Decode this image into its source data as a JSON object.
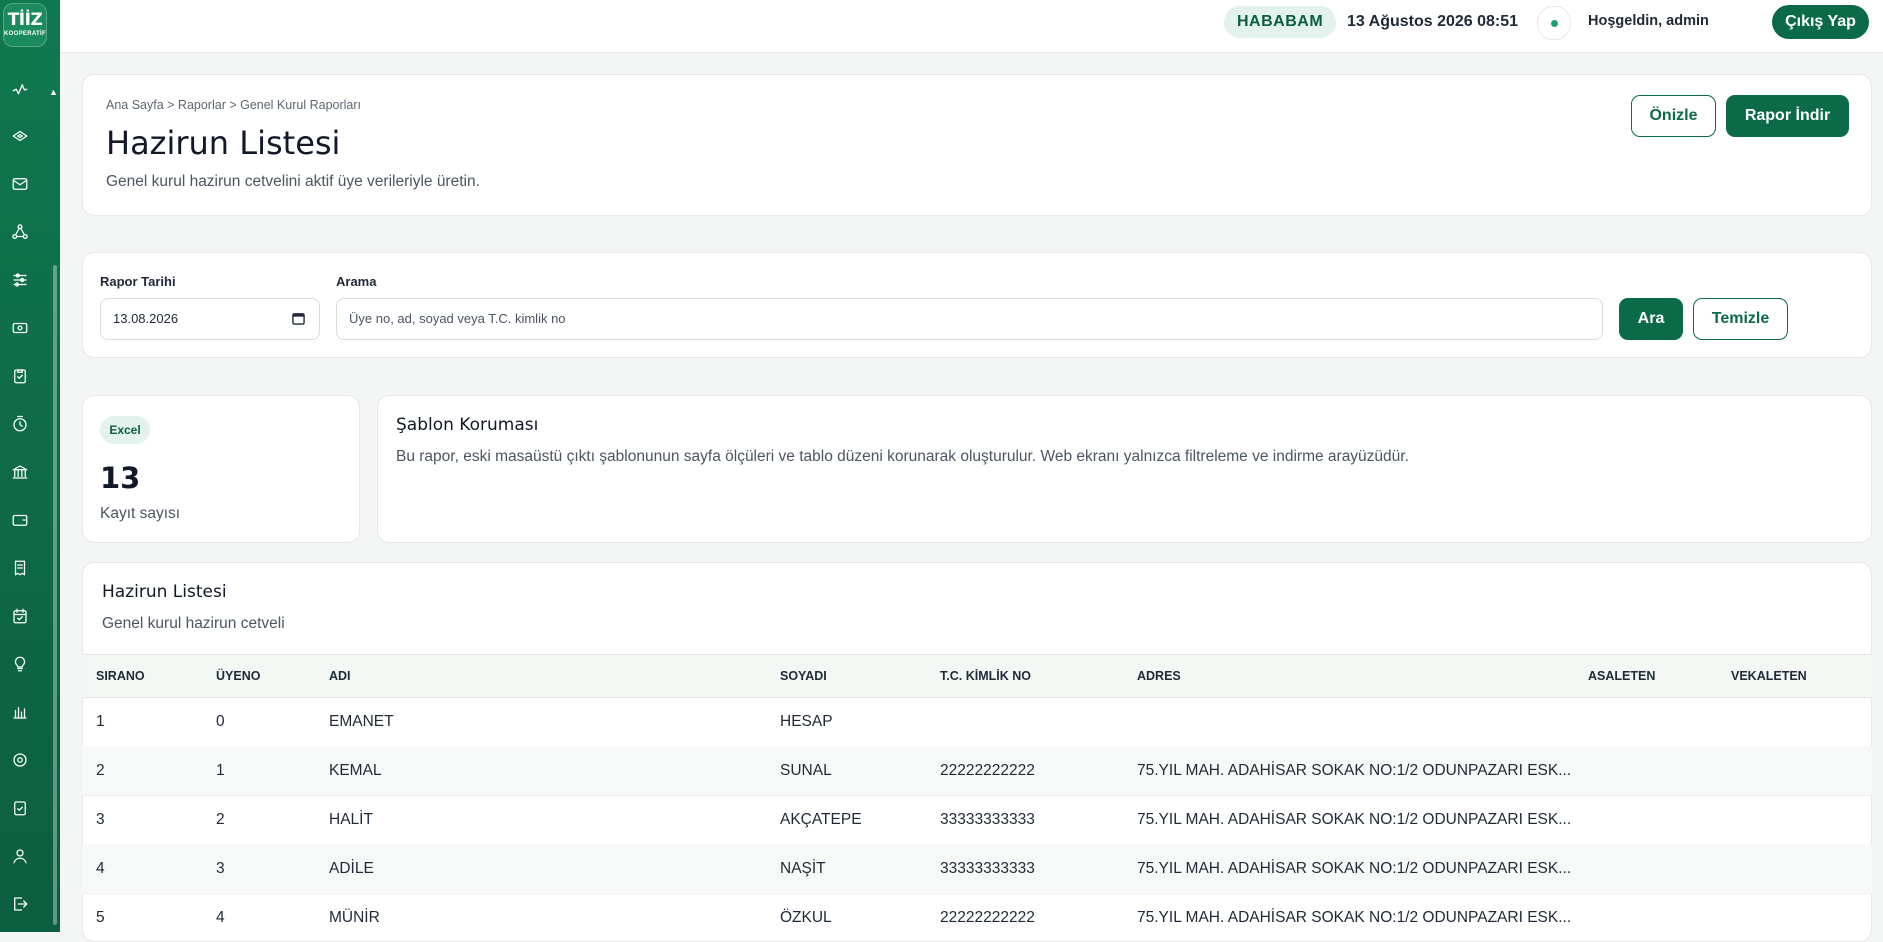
{
  "logo": {
    "line1": "TİİZ",
    "line2": "KOOPERATİF"
  },
  "sidebar": {
    "icons": [
      "activity-icon",
      "layers-icon",
      "mail-icon",
      "network-icon",
      "sliders-icon",
      "cash-icon",
      "clipboard-check-icon",
      "timer-icon",
      "bank-icon",
      "wallet-icon",
      "receipt-icon",
      "calendar-check-icon",
      "lightbulb-icon",
      "bar-chart-icon",
      "settings-icon",
      "clipboard-icon",
      "user-icon",
      "logout-icon"
    ]
  },
  "header": {
    "org": "HABABAM",
    "datetime": "13 Ağustos 2026 08:51",
    "welcome": "Hoşgeldin, admin",
    "logout": "Çıkış Yap"
  },
  "page": {
    "breadcrumb": "Ana Sayfa > Raporlar > Genel Kurul Raporları",
    "title": "Hazirun Listesi",
    "subtitle": "Genel kurul hazirun cetvelini aktif üye verileriyle üretin.",
    "preview_button": "Önizle",
    "download_button": "Rapor İndir"
  },
  "filters": {
    "date_label": "Rapor Tarihi",
    "date_value": "13.08.2026",
    "search_label": "Arama",
    "search_placeholder": "Üye no, ad, soyad veya T.C. kimlik no",
    "search_button": "Ara",
    "clear_button": "Temizle"
  },
  "stats": {
    "badge": "Excel",
    "count": "13",
    "count_label": "Kayıt sayısı"
  },
  "template": {
    "title": "Şablon Koruması",
    "text": "Bu rapor, eski masaüstü çıktı şablonunun sayfa ölçüleri ve tablo düzeni korunarak oluşturulur. Web ekranı yalnızca filtreleme ve indirme arayüzüdür."
  },
  "table": {
    "title": "Hazirun Listesi",
    "subtitle": "Genel kurul hazirun cetveli",
    "columns": [
      "SIRANO",
      "ÜYENO",
      "ADI",
      "SOYADI",
      "T.C. KİMLİK NO",
      "ADRES",
      "ASALETEN",
      "VEKALETEN"
    ],
    "rows": [
      [
        "1",
        "0",
        "EMANET",
        "HESAP",
        "",
        "",
        "",
        ""
      ],
      [
        "2",
        "1",
        "KEMAL",
        "SUNAL",
        "22222222222",
        "75.YIL MAH. ADAHİSAR SOKAK NO:1/2 ODUNPAZARI ESK...",
        "",
        ""
      ],
      [
        "3",
        "2",
        "HALİT",
        "AKÇATEPE",
        "33333333333",
        "75.YIL MAH. ADAHİSAR SOKAK NO:1/2 ODUNPAZARI ESK...",
        "",
        ""
      ],
      [
        "4",
        "3",
        "ADİLE",
        "NAŞİT",
        "33333333333",
        "75.YIL MAH. ADAHİSAR SOKAK NO:1/2 ODUNPAZARI ESK...",
        "",
        ""
      ],
      [
        "5",
        "4",
        "MÜNİR",
        "ÖZKUL",
        "22222222222",
        "75.YIL MAH. ADAHİSAR SOKAK NO:1/2 ODUNPAZARI ESK...",
        "",
        ""
      ]
    ]
  },
  "colors": {
    "primary": "#0b6b49",
    "sidebar": "#10784f",
    "badge_bg": "#e3f2ec"
  }
}
